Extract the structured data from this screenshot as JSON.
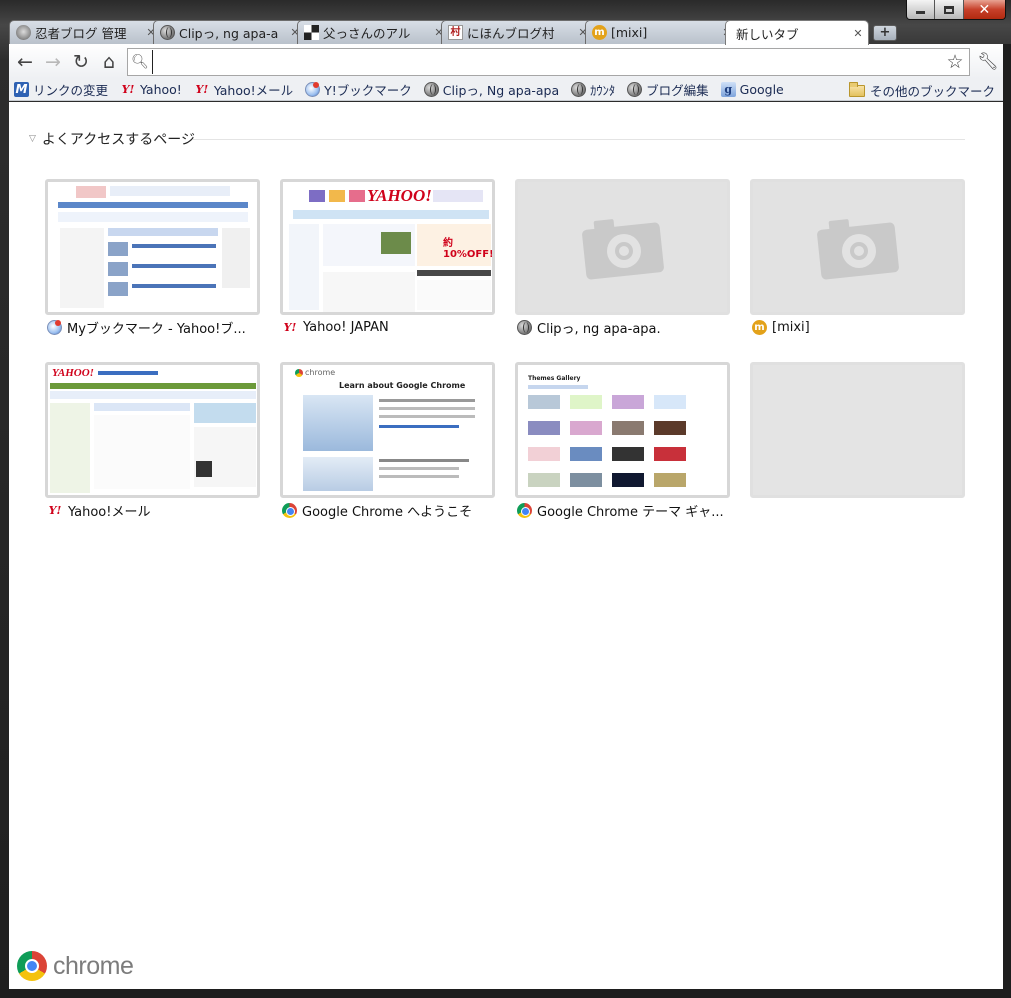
{
  "window": {
    "controls": {
      "minimize": "minimize",
      "maximize": "maximize",
      "close": "✕"
    }
  },
  "tabs": [
    {
      "title": "忍者ブログ 管理",
      "icon": "ninja-icon",
      "active": false
    },
    {
      "title": "Clipっ, ng apa-a",
      "icon": "globe-icon",
      "active": false
    },
    {
      "title": "父っさんのアル",
      "icon": "checker-icon",
      "active": false
    },
    {
      "title": "にほんブログ村",
      "icon": "mura-icon",
      "active": false
    },
    {
      "title": "[mixi]",
      "icon": "mixi-icon",
      "active": false
    },
    {
      "title": "新しいタブ",
      "icon": "",
      "active": true
    }
  ],
  "toolbar": {
    "omnibox_value": "",
    "new_tab_label": "+"
  },
  "bookmarks": [
    {
      "label": "リンクの変更",
      "icon": "m-icon",
      "glyph": "M"
    },
    {
      "label": "Yahoo!",
      "icon": "yahoo-icon",
      "glyph": "Y!"
    },
    {
      "label": "Yahoo!メール",
      "icon": "yahoo-icon",
      "glyph": "Y!"
    },
    {
      "label": "Y!ブックマーク",
      "icon": "ybookmark-icon",
      "glyph": ""
    },
    {
      "label": "Clipっ, Ng apa-apa",
      "icon": "globe-icon",
      "glyph": ""
    },
    {
      "label": "ｶｳﾝﾀ",
      "icon": "globe-icon",
      "glyph": ""
    },
    {
      "label": "ブログ編集",
      "icon": "globe-icon",
      "glyph": ""
    },
    {
      "label": "Google",
      "icon": "google-icon",
      "glyph": "g"
    }
  ],
  "other_bookmarks": "その他のブックマーク",
  "section": {
    "title": "よくアクセスするページ"
  },
  "thumbnails": [
    {
      "label": "Myブックマーク - Yahoo!ブ...",
      "icon": "ybookmark-icon",
      "kind": "ybookmark"
    },
    {
      "label": "Yahoo! JAPAN",
      "icon": "yahoo-icon",
      "kind": "yahoo"
    },
    {
      "label": "Clipっ, ng apa-apa.",
      "icon": "globe-icon",
      "kind": "placeholder"
    },
    {
      "label": "[mixi]",
      "icon": "mixi-icon",
      "kind": "placeholder"
    },
    {
      "label": "Yahoo!メール",
      "icon": "yahoo-icon",
      "kind": "yahoomail"
    },
    {
      "label": "Google Chrome へようこそ",
      "icon": "chrome-icon",
      "kind": "chromewelcome"
    },
    {
      "label": "Google Chrome テーマ ギャ...",
      "icon": "chrome-icon",
      "kind": "themes"
    },
    {
      "label": "",
      "icon": "",
      "kind": "empty"
    }
  ],
  "mini_texts": {
    "yahoo_logo": "YAHOO!",
    "yahoo_banner": "約10%OFF!",
    "chrome_word": "chrome",
    "chrome_headline": "Learn about Google Chrome",
    "themes_title": "Themes Gallery"
  },
  "branding": {
    "word": "chrome"
  },
  "colors": {
    "accent": "#2f62b3",
    "yahoo_red": "#d0021b",
    "placeholder_gray": "#e2e2e2"
  }
}
